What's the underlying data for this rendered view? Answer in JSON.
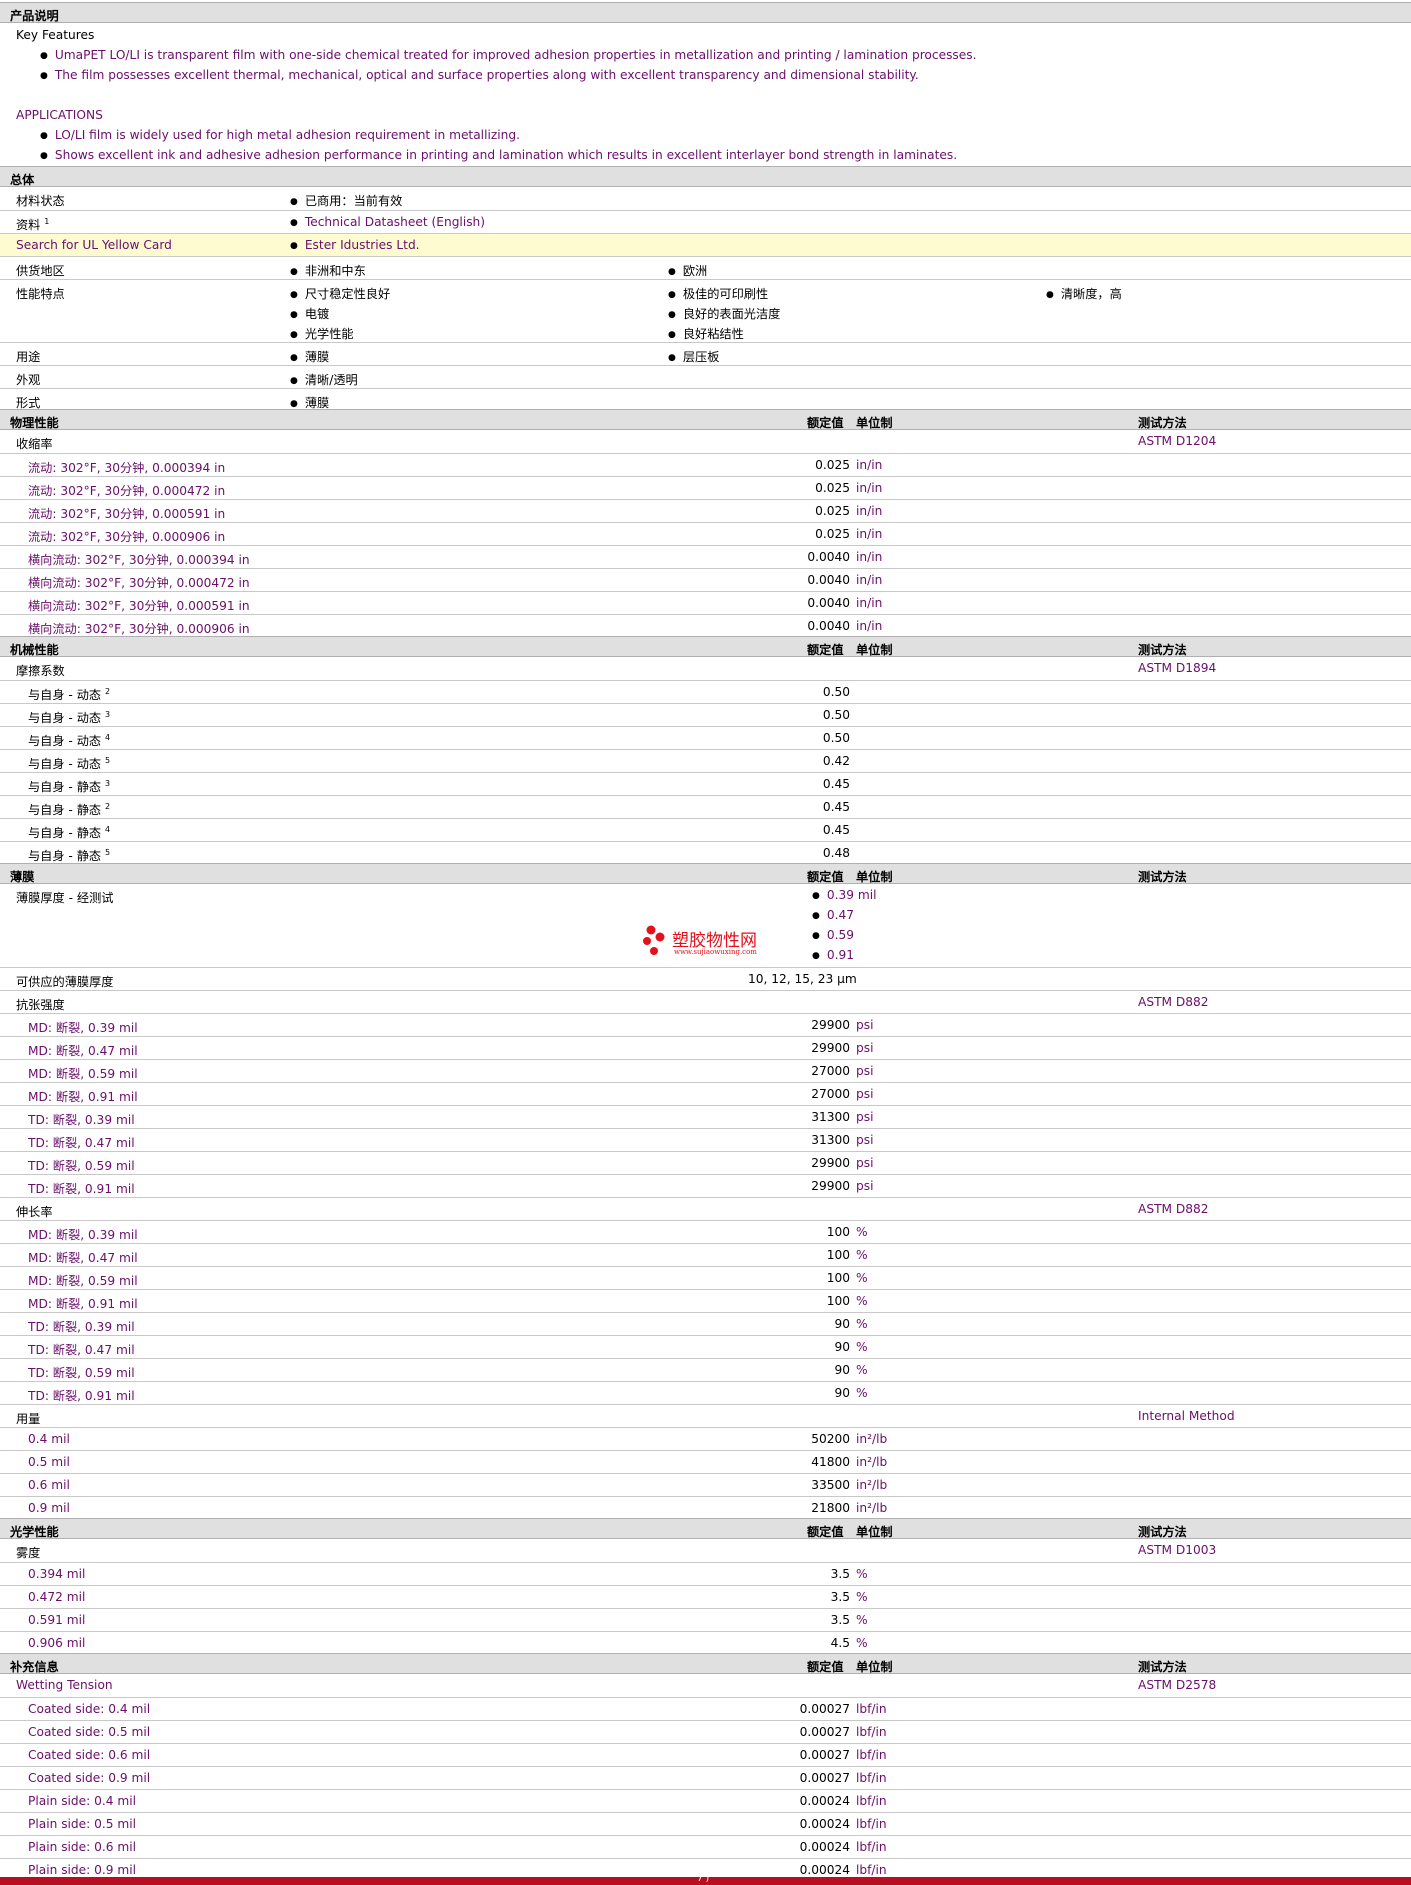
{
  "description": {
    "header": "产品说明",
    "kf_title": "Key Features",
    "kf1": "UmaPET LO/LI is transparent film with one-side chemical treated for improved adhesion properties in metallization and printing / lamination processes.",
    "kf2": "The film possesses excellent thermal, mechanical, optical and surface properties along with excellent transparency and dimensional stability.",
    "app_title": "APPLICATIONS",
    "app1": "LO/LI film is widely used for high metal adhesion requirement in metallizing.",
    "app2": "Shows excellent ink and adhesive adhesion performance in printing and lamination which results in excellent interlayer bond strength in laminates."
  },
  "general": {
    "header": "总体",
    "status_label": "材料状态",
    "status_value": "已商用：当前有效",
    "docs_label": "资料",
    "docs_sup": "1",
    "docs_value": "Technical Datasheet (English)",
    "ul_label": "Search for UL Yellow Card",
    "ul_value": "Ester Idustries Ltd.",
    "region_label": "供货地区",
    "region1": "非洲和中东",
    "region2": "欧洲",
    "features_label": "性能特点",
    "f1": "尺寸稳定性良好",
    "f2": "极佳的可印刷性",
    "f3": "清晰度，高",
    "f4": "电镀",
    "f5": "良好的表面光洁度",
    "f6": "光学性能",
    "f7": "良好粘结性",
    "use_label": "用途",
    "use1": "薄膜",
    "use2": "层压板",
    "appearance_label": "外观",
    "appearance_value": "清晰/透明",
    "form_label": "形式",
    "form_value": "薄膜"
  },
  "col": {
    "nominal": "额定值",
    "unit": "单位制",
    "method": "测试方法"
  },
  "physical": {
    "header": "物理性能",
    "shrink_label": "收缩率",
    "shrink_method": "ASTM D1204",
    "rows": [
      {
        "label": "流动: 302°F, 30分钟, 0.000394 in",
        "value": "0.025",
        "unit": "in/in"
      },
      {
        "label": "流动: 302°F, 30分钟, 0.000472 in",
        "value": "0.025",
        "unit": "in/in"
      },
      {
        "label": "流动: 302°F, 30分钟, 0.000591 in",
        "value": "0.025",
        "unit": "in/in"
      },
      {
        "label": "流动: 302°F, 30分钟, 0.000906 in",
        "value": "0.025",
        "unit": "in/in"
      },
      {
        "label": "横向流动: 302°F, 30分钟, 0.000394 in",
        "value": "0.0040",
        "unit": "in/in"
      },
      {
        "label": "横向流动: 302°F, 30分钟, 0.000472 in",
        "value": "0.0040",
        "unit": "in/in"
      },
      {
        "label": "横向流动: 302°F, 30分钟, 0.000591 in",
        "value": "0.0040",
        "unit": "in/in"
      },
      {
        "label": "横向流动: 302°F, 30分钟, 0.000906 in",
        "value": "0.0040",
        "unit": "in/in"
      }
    ]
  },
  "mechanical": {
    "header": "机械性能",
    "friction_label": "摩擦系数",
    "friction_method": "ASTM D1894",
    "rows": [
      {
        "label": "与自身 - 动态",
        "sup": "2",
        "value": "0.50"
      },
      {
        "label": "与自身 - 动态",
        "sup": "3",
        "value": "0.50"
      },
      {
        "label": "与自身 - 动态",
        "sup": "4",
        "value": "0.50"
      },
      {
        "label": "与自身 - 动态",
        "sup": "5",
        "value": "0.42"
      },
      {
        "label": "与自身 - 静态",
        "sup": "3",
        "value": "0.45"
      },
      {
        "label": "与自身 - 静态",
        "sup": "2",
        "value": "0.45"
      },
      {
        "label": "与自身 - 静态",
        "sup": "4",
        "value": "0.45"
      },
      {
        "label": "与自身 - 静态",
        "sup": "5",
        "value": "0.48"
      }
    ]
  },
  "film": {
    "header": "薄膜",
    "thickness_label": "薄膜厚度 - 经测试",
    "thickness_values": [
      "0.39 mil",
      "0.47",
      "0.59",
      "0.91"
    ],
    "watermark_cn": "塑胶物性网",
    "watermark_url": "www.sujiaowuxing.com",
    "available_label": "可供应的薄膜厚度",
    "available_value": "10, 12, 15, 23 µm",
    "tensile_label": "抗张强度",
    "tensile_method": "ASTM D882",
    "tensile_rows": [
      {
        "label": "MD: 断裂, 0.39 mil",
        "value": "29900",
        "unit": "psi"
      },
      {
        "label": "MD: 断裂, 0.47 mil",
        "value": "29900",
        "unit": "psi"
      },
      {
        "label": "MD: 断裂, 0.59 mil",
        "value": "27000",
        "unit": "psi"
      },
      {
        "label": "MD: 断裂, 0.91 mil",
        "value": "27000",
        "unit": "psi"
      },
      {
        "label": "TD: 断裂, 0.39 mil",
        "value": "31300",
        "unit": "psi"
      },
      {
        "label": "TD: 断裂, 0.47 mil",
        "value": "31300",
        "unit": "psi"
      },
      {
        "label": "TD: 断裂, 0.59 mil",
        "value": "29900",
        "unit": "psi"
      },
      {
        "label": "TD: 断裂, 0.91 mil",
        "value": "29900",
        "unit": "psi"
      }
    ],
    "elong_label": "伸长率",
    "elong_method": "ASTM D882",
    "elong_rows": [
      {
        "label": "MD: 断裂, 0.39 mil",
        "value": "100",
        "unit": "%"
      },
      {
        "label": "MD: 断裂, 0.47 mil",
        "value": "100",
        "unit": "%"
      },
      {
        "label": "MD: 断裂, 0.59 mil",
        "value": "100",
        "unit": "%"
      },
      {
        "label": "MD: 断裂, 0.91 mil",
        "value": "100",
        "unit": "%"
      },
      {
        "label": "TD: 断裂, 0.39 mil",
        "value": "90",
        "unit": "%"
      },
      {
        "label": "TD: 断裂, 0.47 mil",
        "value": "90",
        "unit": "%"
      },
      {
        "label": "TD: 断裂, 0.59 mil",
        "value": "90",
        "unit": "%"
      },
      {
        "label": "TD: 断裂, 0.91 mil",
        "value": "90",
        "unit": "%"
      }
    ],
    "yield_label": "用量",
    "yield_method": "Internal Method",
    "yield_rows": [
      {
        "label": "0.4 mil",
        "value": "50200",
        "unit": "in²/lb"
      },
      {
        "label": "0.5 mil",
        "value": "41800",
        "unit": "in²/lb"
      },
      {
        "label": "0.6 mil",
        "value": "33500",
        "unit": "in²/lb"
      },
      {
        "label": "0.9 mil",
        "value": "21800",
        "unit": "in²/lb"
      }
    ]
  },
  "optical": {
    "header": "光学性能",
    "haze_label": "雾度",
    "haze_method": "ASTM D1003",
    "rows": [
      {
        "label": "0.394 mil",
        "value": "3.5",
        "unit": "%"
      },
      {
        "label": "0.472 mil",
        "value": "3.5",
        "unit": "%"
      },
      {
        "label": "0.591 mil",
        "value": "3.5",
        "unit": "%"
      },
      {
        "label": "0.906 mil",
        "value": "4.5",
        "unit": "%"
      }
    ]
  },
  "supplement": {
    "header": "补充信息",
    "wetting_label": "Wetting Tension",
    "wetting_method": "ASTM D2578",
    "rows": [
      {
        "label": "Coated side: 0.4 mil",
        "value": "0.00027",
        "unit": "lbf/in"
      },
      {
        "label": "Coated side: 0.5 mil",
        "value": "0.00027",
        "unit": "lbf/in"
      },
      {
        "label": "Coated side: 0.6 mil",
        "value": "0.00027",
        "unit": "lbf/in"
      },
      {
        "label": "Coated side: 0.9 mil",
        "value": "0.00027",
        "unit": "lbf/in"
      },
      {
        "label": "Plain side: 0.4 mil",
        "value": "0.00024",
        "unit": "lbf/in"
      },
      {
        "label": "Plain side: 0.5 mil",
        "value": "0.00024",
        "unit": "lbf/in"
      },
      {
        "label": "Plain side: 0.6 mil",
        "value": "0.00024",
        "unit": "lbf/in"
      },
      {
        "label": "Plain side: 0.9 mil",
        "value": "0.00024",
        "unit": "lbf/in"
      }
    ]
  },
  "footer": {
    "partial_text": "7 )"
  }
}
